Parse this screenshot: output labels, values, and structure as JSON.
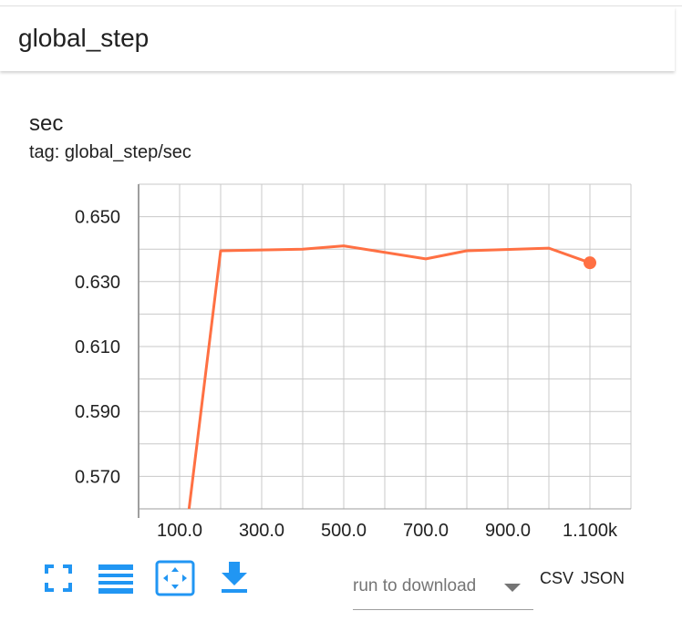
{
  "header": {
    "title": "global_step"
  },
  "card": {
    "title": "sec",
    "tag": "tag: global_step/sec"
  },
  "colors": {
    "series": "#ff7043",
    "accent": "#2196f3",
    "grid": "#c8c8c8",
    "axis": "#9e9e9e"
  },
  "chart_data": {
    "type": "line",
    "title": "",
    "xlabel": "",
    "ylabel": "",
    "xlim": [
      0,
      1200
    ],
    "ylim": [
      0.56,
      0.66
    ],
    "xticks": [
      100,
      300,
      500,
      700,
      900,
      1100
    ],
    "xtick_labels": [
      "100.0",
      "300.0",
      "500.0",
      "700.0",
      "900.0",
      "1.100k"
    ],
    "yticks": [
      0.57,
      0.59,
      0.61,
      0.63,
      0.65
    ],
    "ytick_labels": [
      "0.570",
      "0.590",
      "0.610",
      "0.630",
      "0.650"
    ],
    "grid": true,
    "series": [
      {
        "x": [
          123,
          200,
          400,
          500,
          700,
          800,
          1000,
          1100
        ],
        "y": [
          0.56,
          0.6395,
          0.64,
          0.641,
          0.637,
          0.6395,
          0.6403,
          0.6358
        ]
      }
    ]
  },
  "toolbar": {
    "fullscreen_icon": "fullscreen-icon",
    "list_icon": "list-icon",
    "fit_icon": "fit-domain-icon",
    "download_icon": "download-icon"
  },
  "download": {
    "placeholder": "run to download",
    "csv": "CSV",
    "json": "JSON"
  }
}
